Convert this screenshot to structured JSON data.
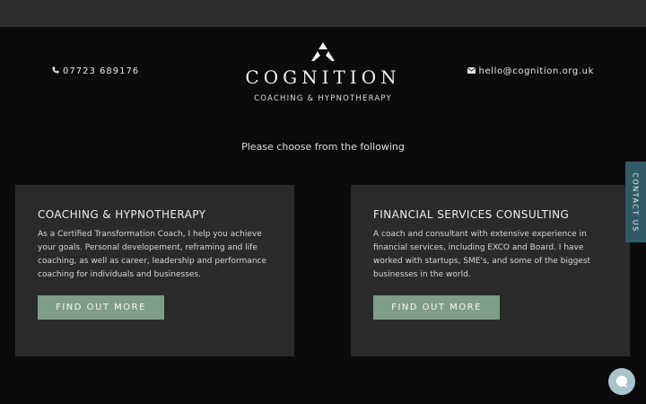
{
  "header": {
    "phone": "07723 689176",
    "email": "hello@cognition.org.uk",
    "brand": "COGNITION",
    "tagline": "COACHING & HYPNOTHERAPY"
  },
  "intro": "Please choose from the following",
  "cards": [
    {
      "title": "COACHING & HYPNOTHERAPY",
      "text": "As a Certified Transformation Coach, I help you achieve your goals.  Personal developement, reframing and life coaching, as well as career, leadership and performance coaching for individuals and businesses.",
      "button": "FIND OUT MORE"
    },
    {
      "title": "FINANCIAL SERVICES CONSULTING",
      "text": "A coach and consultant with extensive experience in financial services, including EXCO and Board. I have worked with startups, SME's, and some of the biggest businesses in the world.",
      "button": "FIND OUT MORE"
    }
  ],
  "contact_tab": "CONTACT US",
  "colors": {
    "background": "#0b0b0b",
    "topbar": "#2f2f2f",
    "card": "#2a2a2a",
    "button": "#7e9d87",
    "contact_tab": "#2f5a66",
    "chat": "#a9c4cc"
  },
  "icons": [
    "phone-icon",
    "mail-icon",
    "logo-triangle-icon",
    "chat-bubble-icon"
  ]
}
